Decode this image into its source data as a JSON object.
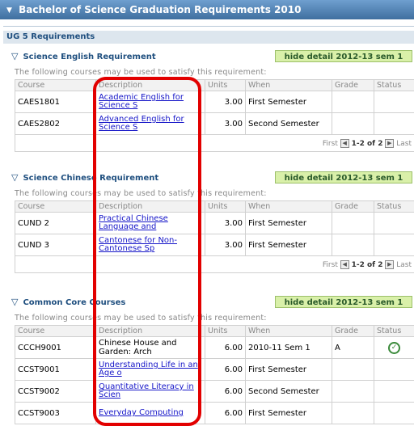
{
  "header": {
    "title": "Bachelor of Science Graduation Requirements 2010"
  },
  "group": {
    "title": "UG 5 Requirements"
  },
  "columns": [
    "Course",
    "Description",
    "Units",
    "When",
    "Grade",
    "Status"
  ],
  "note": "The following courses may be used to satisfy this requirement:",
  "sections": [
    {
      "title": "Science English Requirement",
      "button": "hide detail 2012-13 sem 1",
      "rows": [
        {
          "course": "CAES1801",
          "description": "Academic English for Science S",
          "units": "3.00",
          "when": "First Semester",
          "grade": "",
          "status": ""
        },
        {
          "course": "CAES2802",
          "description": "Advanced English for Science S",
          "units": "3.00",
          "when": "Second Semester",
          "grade": "",
          "status": ""
        }
      ],
      "pager": {
        "first": "First",
        "range": "1-2 of 2",
        "last": "Last"
      }
    },
    {
      "title": "Science Chinese Requirement",
      "button": "hide detail 2012-13 sem 1",
      "rows": [
        {
          "course": "CUND 2",
          "description": "Practical Chinese Language and",
          "units": "3.00",
          "when": "First Semester",
          "grade": "",
          "status": ""
        },
        {
          "course": "CUND 3",
          "description": "Cantonese for Non-Cantonese Sp",
          "units": "3.00",
          "when": "First Semester",
          "grade": "",
          "status": ""
        }
      ],
      "pager": {
        "first": "First",
        "range": "1-2 of 2",
        "last": "Last"
      }
    },
    {
      "title": "Common Core Courses",
      "button": "hide detail 2012-13 sem 1",
      "rows": [
        {
          "course": "CCCH9001",
          "description": "Chinese House and Garden: Arch",
          "units": "6.00",
          "when": "2010-11 Sem 1",
          "grade": "A",
          "status": "completed"
        },
        {
          "course": "CCST9001",
          "description": "Understanding Life in an Age o",
          "units": "6.00",
          "when": "First Semester",
          "grade": "",
          "status": ""
        },
        {
          "course": "CCST9002",
          "description": "Quantitative Literacy in Scien",
          "units": "6.00",
          "when": "Second Semester",
          "grade": "",
          "status": ""
        },
        {
          "course": "CCST9003",
          "description": "Everyday Computing",
          "units": "6.00",
          "when": "First Semester",
          "grade": "",
          "status": ""
        }
      ]
    }
  ],
  "colors": {
    "header_bg": "#4f7faf",
    "button_bg": "#d9f0a9",
    "link": "#1515c8",
    "annotation": "#e20000"
  },
  "icons": {
    "collapse": "triangle-down-icon",
    "status_ok": "checkmark-circle-icon",
    "prev": "arrow-left-icon",
    "next": "arrow-right-icon"
  }
}
